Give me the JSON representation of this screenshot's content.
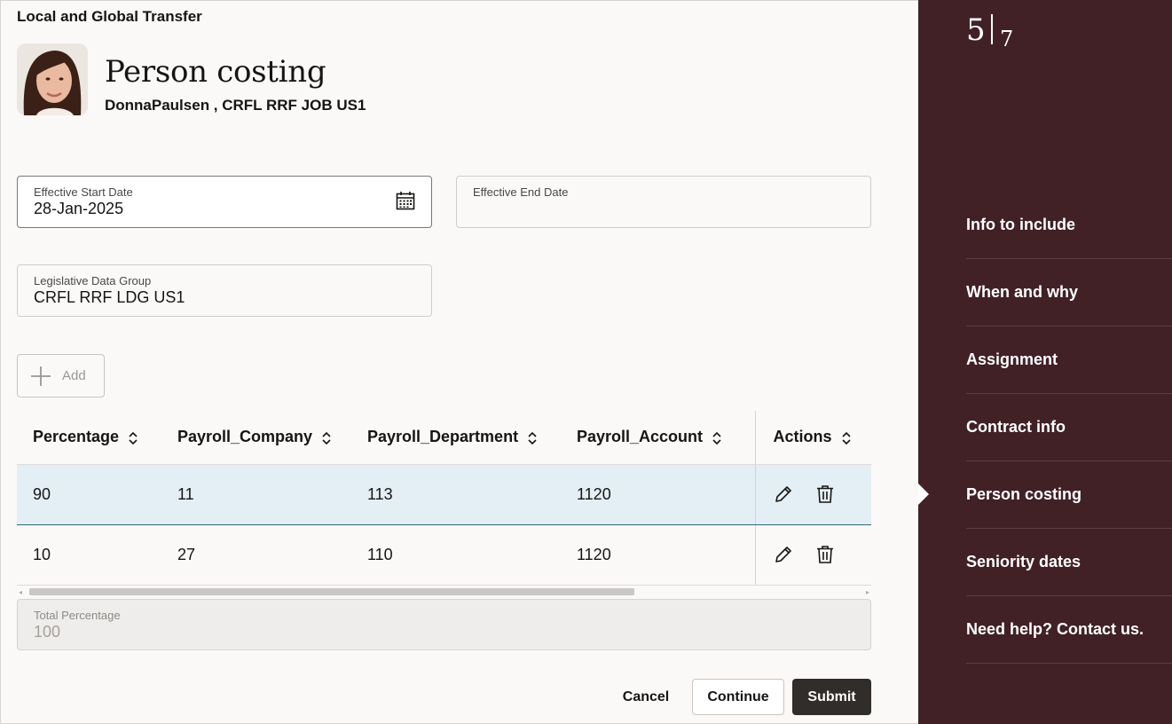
{
  "header": {
    "flow_title": "Local and Global Transfer",
    "page_title": "Person costing",
    "person_subtitle": "DonnaPaulsen , CRFL RRF JOB US1"
  },
  "form": {
    "effective_start_date": {
      "label": "Effective Start Date",
      "value": "28-Jan-2025",
      "icon": "calendar-icon"
    },
    "effective_end_date": {
      "label": "Effective End Date",
      "value": ""
    },
    "legislative_data_group": {
      "label": "Legislative Data Group",
      "value": "CRFL RRF LDG US1"
    },
    "total_percentage": {
      "label": "Total Percentage",
      "value": "100"
    }
  },
  "toolbar": {
    "add_label": "Add",
    "add_icon": "plus-icon"
  },
  "table": {
    "columns": [
      "Percentage",
      "Payroll_Company",
      "Payroll_Department",
      "Payroll_Account",
      "Actions"
    ],
    "rows": [
      {
        "percentage": "90",
        "company": "11",
        "department": "113",
        "account": "1120",
        "selected": true
      },
      {
        "percentage": "10",
        "company": "27",
        "department": "110",
        "account": "1120",
        "selected": false
      }
    ],
    "row_actions": [
      "pencil-icon",
      "trash-icon"
    ]
  },
  "footer": {
    "cancel_label": "Cancel",
    "continue_label": "Continue",
    "submit_label": "Submit"
  },
  "sidebar": {
    "current_step": "5",
    "total_steps": "7",
    "steps": [
      {
        "label": "Info to include",
        "current": false
      },
      {
        "label": "When and why",
        "current": false
      },
      {
        "label": "Assignment",
        "current": false
      },
      {
        "label": "Contract info",
        "current": false
      },
      {
        "label": "Person costing",
        "current": true
      },
      {
        "label": "Seniority dates",
        "current": false
      },
      {
        "label": "Need help? Contact us.",
        "current": false
      }
    ]
  },
  "colors": {
    "sidebar_bg": "#412126",
    "selected_row": "#e4eef5",
    "submit_bg": "#312d2a",
    "page_bg": "#fbf9f8"
  }
}
